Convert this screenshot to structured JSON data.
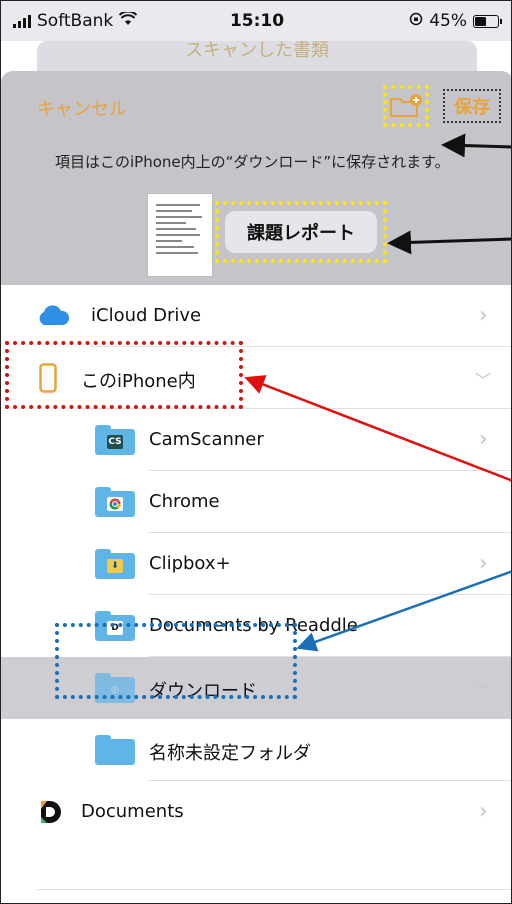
{
  "status_bar": {
    "carrier": "SoftBank",
    "time": "15:10",
    "battery": "45%",
    "battery_level": 0.45
  },
  "background_sheet_title": "スキャンした書類",
  "header": {
    "cancel_label": "キャンセル",
    "save_label": "保存",
    "info_text": "項目はこのiPhone内上の“ダウンロード”に保存されます。",
    "document_name": "課題レポート"
  },
  "list": {
    "icloud": "iCloud Drive",
    "on_iphone": "このiPhone内",
    "folders": [
      "CamScanner",
      "Chrome",
      "Clipbox+",
      "Documents by Readdle",
      "ダウンロード",
      "名称未設定フォルダ"
    ],
    "documents": "Documents"
  },
  "colors": {
    "accent": "#e8a43a",
    "yellow_highlight": "#ffe600",
    "red_highlight": "#e01010",
    "blue_highlight": "#1a6fb8"
  }
}
